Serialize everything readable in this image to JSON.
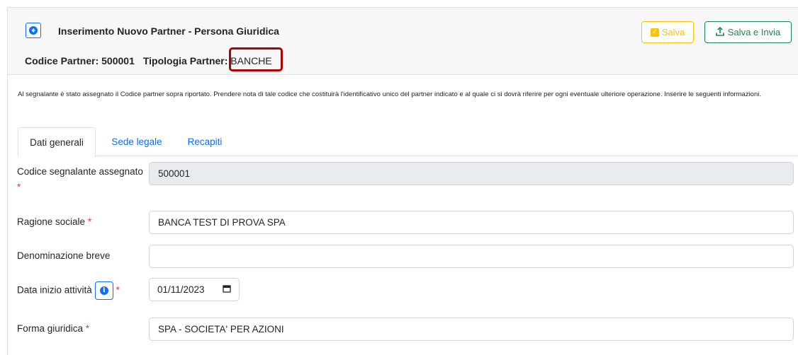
{
  "header": {
    "title": "Inserimento Nuovo Partner - Persona Giuridica",
    "codice_label": "Codice Partner:",
    "codice_value": "500001",
    "tipologia_label": "Tipologia Partner:",
    "tipologia_value": "BANCHE",
    "back_icon": "arrow-left-circle-icon",
    "highlight_color": "#b00000"
  },
  "toolbar": {
    "save_label": "Salva",
    "save_icon": "check-square-icon",
    "save_color": "#ffc107",
    "send_label": "Salva e Invia",
    "send_icon": "upload-icon",
    "send_color": "#198754"
  },
  "notice": "Al segnalante è stato assegnato il Codice partner sopra riportato. Prendere nota di tale codice che costituirà l'identificativo unico del partner indicato e al quale ci si dovrà riferire per ogni eventuale ulteriore operazione. Inserire le seguenti informazioni.",
  "tabs": [
    {
      "label": "Dati generali",
      "active": true
    },
    {
      "label": "Sede legale",
      "active": false
    },
    {
      "label": "Recapiti",
      "active": false
    }
  ],
  "form": {
    "codice_segnalante": {
      "label": "Codice segnalante assegnato",
      "value": "500001",
      "required": "*"
    },
    "ragione_sociale": {
      "label": "Ragione sociale",
      "value": "BANCA TEST DI PROVA SPA",
      "required": "*"
    },
    "denominazione_breve": {
      "label": "Denominazione breve",
      "value": ""
    },
    "data_inizio": {
      "label": "Data inizio attività",
      "value": "01/11/2023",
      "required": "*",
      "info_icon": "info-circle-icon",
      "calendar_icon": "calendar-icon"
    },
    "forma_giuridica": {
      "label": "Forma giuridica",
      "value": "SPA - SOCIETA' PER AZIONI",
      "required": "*"
    }
  },
  "colors": {
    "primary": "#0d6efd",
    "required": "#dc3545",
    "readonly_bg": "#e9ecef"
  }
}
